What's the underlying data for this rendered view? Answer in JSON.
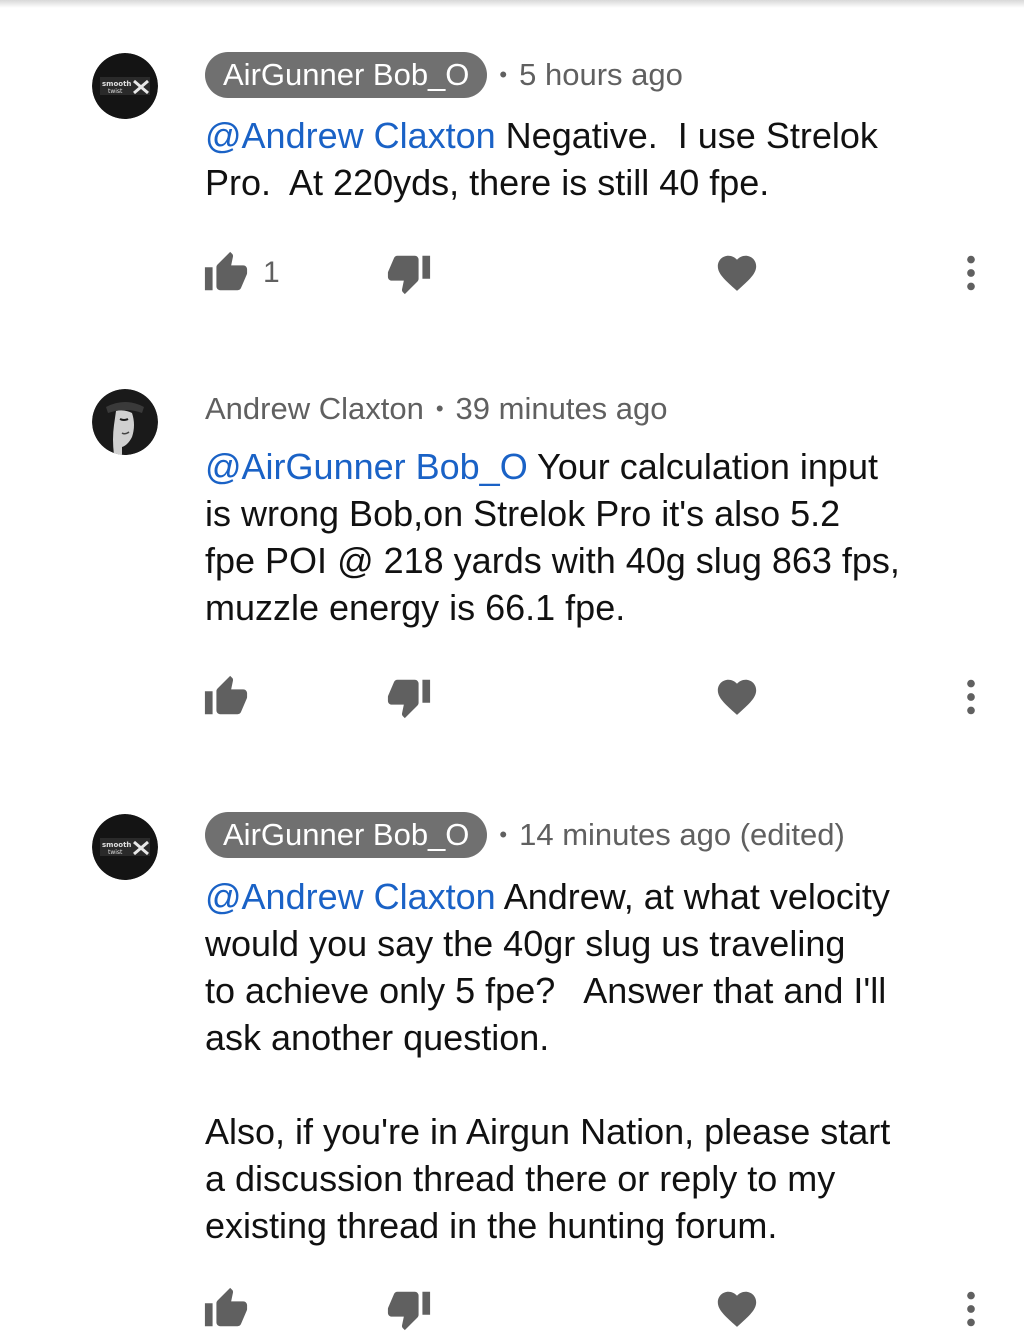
{
  "comments": [
    {
      "author": "AirGunner Bob_O",
      "author_style": "chip",
      "avatar": "smooth-twist-logo",
      "time": "5 hours ago",
      "mention": "@Andrew Claxton",
      "text": " Negative.  I use Strelok\nPro.  At 220yds, there is still 40 fpe.",
      "likes": "1"
    },
    {
      "author": "Andrew Claxton",
      "author_style": "plain",
      "avatar": "face-silhouette",
      "time": "39 minutes ago",
      "mention": "@AirGunner Bob_O",
      "text": " Your calculation input\nis wrong Bob,on Strelok Pro it's also 5.2\nfpe POI @ 218 yards with 40g slug 863 fps,\nmuzzle energy is 66.1 fpe.",
      "likes": ""
    },
    {
      "author": "AirGunner Bob_O",
      "author_style": "chip",
      "avatar": "smooth-twist-logo",
      "time": "14 minutes ago (edited)",
      "mention": "@Andrew Claxton",
      "text": " Andrew, at what velocity\nwould you say the 40gr slug us traveling\nto achieve only 5 fpe?   Answer that and I'll\nask another question.\n\nAlso, if you're in Airgun Nation, please start\na discussion thread there or reply to my\nexisting thread in the hunting forum.",
      "likes": ""
    }
  ],
  "separator": "•",
  "icons": {
    "like": "thumbs-up-icon",
    "dislike": "thumbs-down-icon",
    "heart": "heart-icon",
    "more": "more-vert-icon"
  },
  "colors": {
    "mention": "#1a62c6",
    "chip_bg": "#707070",
    "icon": "#606060",
    "text": "#111111"
  }
}
